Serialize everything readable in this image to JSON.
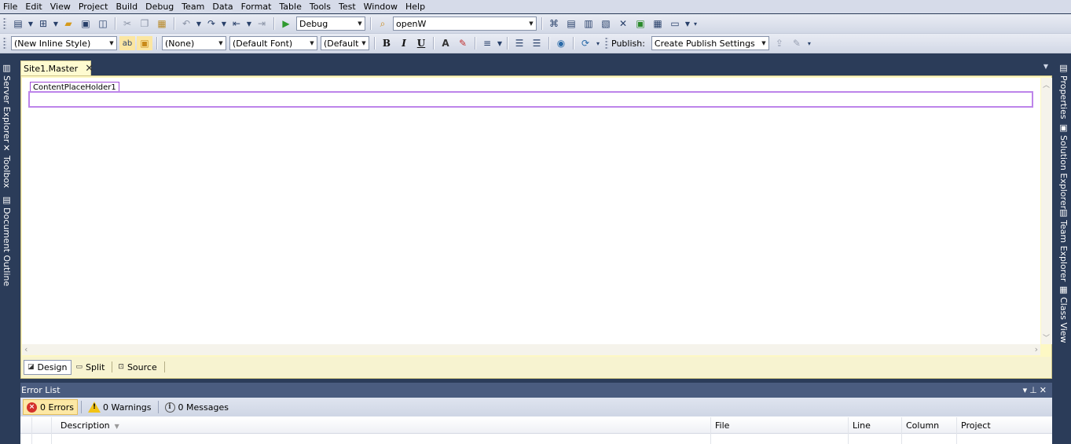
{
  "menu": [
    "File",
    "Edit",
    "View",
    "Project",
    "Build",
    "Debug",
    "Team",
    "Data",
    "Format",
    "Table",
    "Tools",
    "Test",
    "Window",
    "Help"
  ],
  "toolbar1": {
    "config_combo": "Debug",
    "find_combo": "openW"
  },
  "toolbar2": {
    "style_combo": "(New Inline Style)",
    "block_combo": "(None)",
    "font_combo": "(Default Font)",
    "size_combo": "(Default",
    "bold": "B",
    "italic": "I",
    "underline": "U",
    "publish_label": "Publish:",
    "publish_combo": "Create Publish Settings"
  },
  "left_tabs": [
    "Server Explorer",
    "Toolbox",
    "Document Outline"
  ],
  "right_tabs": [
    "Properties",
    "Solution Explorer",
    "Team Explorer",
    "Class View"
  ],
  "document": {
    "tab_title": "Site1.Master",
    "placeholder_label": "ContentPlaceHolder1"
  },
  "views": {
    "design": "Design",
    "split": "Split",
    "source": "Source",
    "active": "Design"
  },
  "error_list": {
    "title": "Error List",
    "errors": "0 Errors",
    "warnings": "0 Warnings",
    "messages": "0 Messages",
    "columns": {
      "description": "Description",
      "file": "File",
      "line": "Line",
      "column": "Column",
      "project": "Project"
    }
  }
}
